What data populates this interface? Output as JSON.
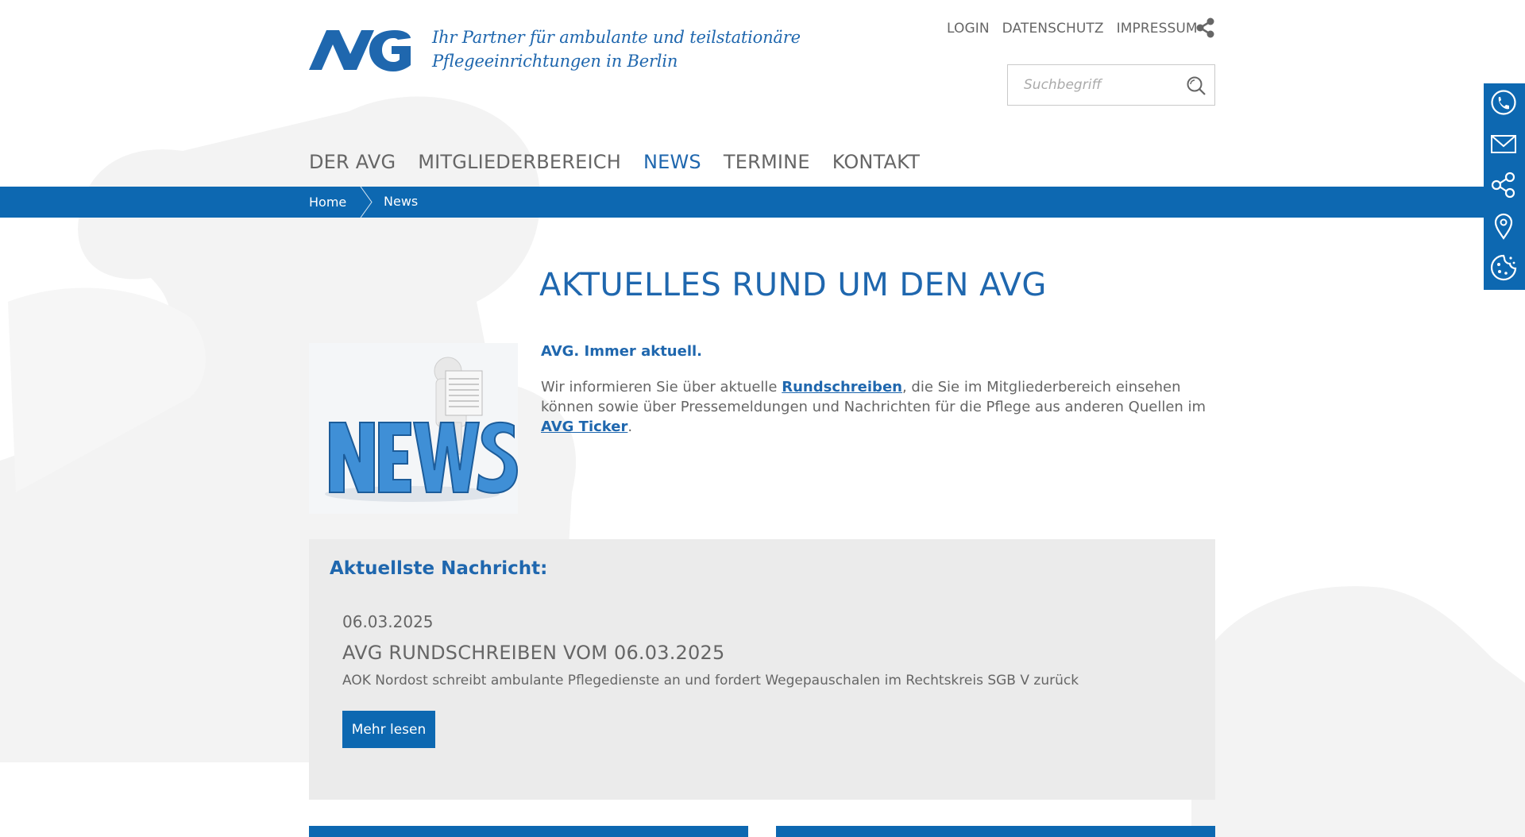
{
  "header": {
    "logo_text": "AVG",
    "tagline_line1": "Ihr Partner für ambulante und teilstationäre",
    "tagline_line2": "Pflegeeinrichtungen in Berlin",
    "top_links": [
      "LOGIN",
      "DATENSCHUTZ",
      "IMPRESSUM"
    ],
    "search_placeholder": "Suchbegriff"
  },
  "nav": {
    "items": [
      {
        "label": "DER AVG",
        "active": false
      },
      {
        "label": "MITGLIEDERBEREICH",
        "active": false
      },
      {
        "label": "NEWS",
        "active": true
      },
      {
        "label": "TERMINE",
        "active": false
      },
      {
        "label": "KONTAKT",
        "active": false
      }
    ]
  },
  "breadcrumb": {
    "home": "Home",
    "current": "News"
  },
  "sidebar": {
    "icons": [
      "phone-icon",
      "mail-icon",
      "share-icon",
      "location-icon",
      "cookie-icon"
    ]
  },
  "main": {
    "title": "AKTUELLES RUND UM DEN AVG",
    "image_alt": "NEWS",
    "intro_strong": "AVG. Immer aktuell.",
    "intro_part1": "Wir informieren Sie über aktuelle ",
    "link1": "Rundschreiben",
    "intro_part2": ", die Sie im Mitgliederbereich einsehen können sowie über Pressemeldungen und Nachrichten für die Pflege aus anderen Quellen im ",
    "link2": "AVG Ticker",
    "intro_part3": "."
  },
  "latest": {
    "heading": "Aktuellste Nachricht:",
    "date": "06.03.2025",
    "title": "AVG RUNDSCHREIBEN VOM 06.03.2025",
    "text": "AOK Nordost schreibt ambulante Pflegedienste an und fordert Wegepauschalen im Rechtskreis SGB V zurück",
    "button": "Mehr lesen"
  },
  "colors": {
    "brand": "#0d68b1",
    "title": "#1f67ae",
    "box": "#ebebeb"
  }
}
